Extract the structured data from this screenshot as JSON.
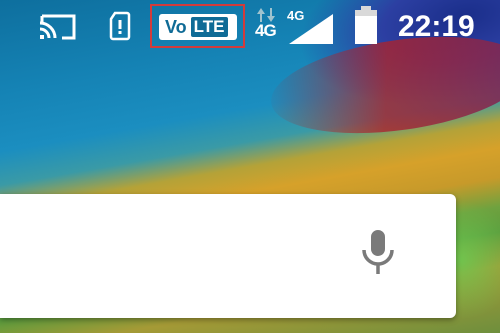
{
  "status_bar": {
    "clock": "22:19",
    "network_type_top": "4G",
    "network_type_data": "4G",
    "volte_badge": {
      "vo": "Vo",
      "lte": "LTE"
    },
    "icons": [
      "cast-icon",
      "sd-card-icon",
      "volte-icon",
      "data-activity-icon",
      "signal-icon",
      "battery-icon"
    ],
    "highlight_color": "#d23b3b"
  },
  "search_bar": {
    "icons": [
      "mic-icon"
    ]
  },
  "colors": {
    "status_text": "#ffffff",
    "volte_blue": "#0f6b96",
    "search_bg": "#ffffff",
    "mic_gray": "#7a7a7a"
  }
}
